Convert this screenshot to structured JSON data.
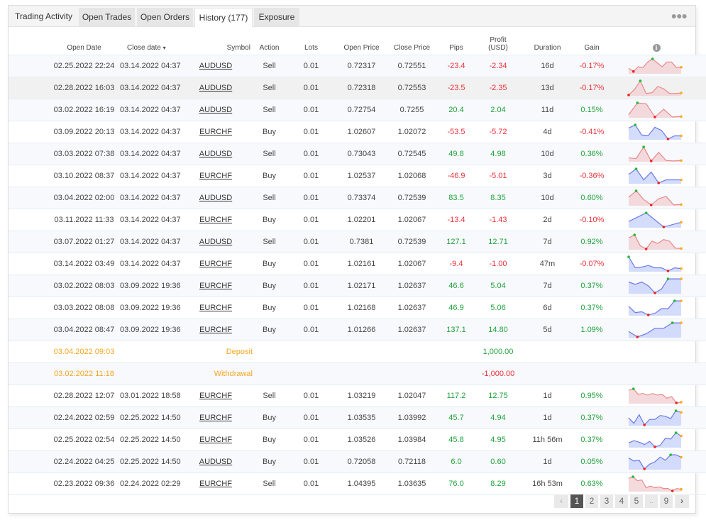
{
  "tabs": [
    {
      "label": "Trading Activity"
    },
    {
      "label": "Open Trades"
    },
    {
      "label": "Open Orders"
    },
    {
      "label": "History (177)",
      "active": true
    },
    {
      "label": "Exposure"
    }
  ],
  "more_icon": "ellipsis-icon",
  "columns": {
    "open_date": "Open Date",
    "close_date": "Close date",
    "close_date_sort": "▾",
    "symbol": "Symbol",
    "action": "Action",
    "lots": "Lots",
    "open_price": "Open Price",
    "close_price": "Close Price",
    "pips": "Pips",
    "profit_line1": "Profit",
    "profit_line2": "(USD)",
    "duration": "Duration",
    "gain": "Gain",
    "info_icon": "i"
  },
  "colors": {
    "positive": "#20a33c",
    "negative": "#e8333b",
    "transaction": "#f5a623",
    "sell_chart_line": "#e88a8a",
    "sell_chart_fill": "#f2d4d6",
    "buy_chart_line": "#6b79e6",
    "buy_chart_fill": "#cdd6fb",
    "marker_high": "#22bb33",
    "marker_low": "#ee2222",
    "marker_end": "#ffaa22"
  },
  "rows": [
    {
      "type": "trade",
      "open_date": "02.25.2022 22:24",
      "close_date": "03.14.2022 04:37",
      "symbol": "AUDUSD",
      "action": "Sell",
      "lots": "0.01",
      "open_price": "0.72317",
      "close_price": "0.72551",
      "pips": "-23.4",
      "profit": "-2.34",
      "duration": "16d",
      "gain": "-0.17%",
      "sign": "neg",
      "spark": [
        0.35,
        0.15,
        0.45,
        0.4,
        0.75,
        0.95,
        0.7,
        0.45,
        0.75,
        0.75,
        0.4,
        0.42
      ],
      "hi": 5,
      "lo": 1
    },
    {
      "type": "trade",
      "open_date": "02.28.2022 16:03",
      "close_date": "03.14.2022 04:37",
      "symbol": "AUDUSD",
      "action": "Sell",
      "lots": "0.01",
      "open_price": "0.72318",
      "close_price": "0.72553",
      "pips": "-23.5",
      "profit": "-2.35",
      "duration": "13d",
      "gain": "-0.17%",
      "sign": "neg",
      "spark": [
        0.05,
        0.4,
        0.95,
        0.15,
        0.2,
        0.6,
        0.45,
        0.15,
        0.15,
        0.18
      ],
      "hi": 2,
      "lo": 0
    },
    {
      "type": "trade",
      "open_date": "03.02.2022 16:19",
      "close_date": "03.14.2022 04:37",
      "symbol": "AUDUSD",
      "action": "Sell",
      "lots": "0.01",
      "open_price": "0.72754",
      "close_price": "0.7255",
      "pips": "20.4",
      "profit": "2.04",
      "duration": "11d",
      "gain": "0.15%",
      "sign": "pos",
      "spark": [
        0.2,
        0.95,
        0.9,
        0.05,
        0.55,
        0.05,
        0.08
      ],
      "hi": 1,
      "lo": 3
    },
    {
      "type": "trade",
      "open_date": "03.09.2022 20:13",
      "close_date": "03.14.2022 04:37",
      "symbol": "EURCHF",
      "action": "Buy",
      "lots": "0.01",
      "open_price": "1.02607",
      "close_price": "1.02072",
      "pips": "-53.5",
      "profit": "-5.72",
      "duration": "4d",
      "gain": "-0.41%",
      "sign": "neg",
      "spark": [
        0.75,
        0.95,
        0.3,
        0.28,
        0.8,
        0.6,
        0.05,
        0.25,
        0.25
      ],
      "hi": 1,
      "lo": 6
    },
    {
      "type": "trade",
      "open_date": "03.03.2022 07:38",
      "close_date": "03.14.2022 04:37",
      "symbol": "AUDUSD",
      "action": "Sell",
      "lots": "0.01",
      "open_price": "0.73043",
      "close_price": "0.72545",
      "pips": "49.8",
      "profit": "4.98",
      "duration": "10d",
      "gain": "0.36%",
      "sign": "pos",
      "spark": [
        0.25,
        0.2,
        0.95,
        0.05,
        0.6,
        0.08,
        0.05,
        0.08
      ],
      "hi": 2,
      "lo": 3
    },
    {
      "type": "trade",
      "open_date": "03.10.2022 08:37",
      "close_date": "03.14.2022 04:37",
      "symbol": "EURCHF",
      "action": "Buy",
      "lots": "0.01",
      "open_price": "1.02537",
      "close_price": "1.02068",
      "pips": "-46.9",
      "profit": "-5.01",
      "duration": "3d",
      "gain": "-0.36%",
      "sign": "neg",
      "spark": [
        0.6,
        0.95,
        0.25,
        0.75,
        0.05,
        0.25,
        0.25,
        0.25
      ],
      "hi": 1,
      "lo": 4
    },
    {
      "type": "trade",
      "open_date": "03.04.2022 02:00",
      "close_date": "03.14.2022 04:37",
      "symbol": "AUDUSD",
      "action": "Sell",
      "lots": "0.01",
      "open_price": "0.73374",
      "close_price": "0.72539",
      "pips": "83.5",
      "profit": "8.35",
      "duration": "10d",
      "gain": "0.60%",
      "sign": "pos",
      "spark": [
        0.55,
        0.95,
        0.4,
        0.05,
        0.45,
        0.6,
        0.05,
        0.08
      ],
      "hi": 1,
      "lo": 3
    },
    {
      "type": "trade",
      "open_date": "03.11.2022 11:33",
      "close_date": "03.14.2022 04:37",
      "symbol": "EURCHF",
      "action": "Buy",
      "lots": "0.01",
      "open_price": "1.02201",
      "close_price": "1.02067",
      "pips": "-13.4",
      "profit": "-1.43",
      "duration": "2d",
      "gain": "-0.10%",
      "sign": "neg",
      "spark": [
        0.4,
        0.95,
        0.05,
        0.35
      ],
      "hi": 1,
      "lo": 2
    },
    {
      "type": "trade",
      "open_date": "03.07.2022 01:27",
      "close_date": "03.14.2022 04:37",
      "symbol": "AUDUSD",
      "action": "Sell",
      "lots": "0.01",
      "open_price": "0.7381",
      "close_price": "0.72539",
      "pips": "127.1",
      "profit": "12.71",
      "duration": "7d",
      "gain": "0.92%",
      "sign": "pos",
      "spark": [
        0.75,
        0.95,
        0.25,
        0.05,
        0.55,
        0.4,
        0.65,
        0.55,
        0.1,
        0.08
      ],
      "hi": 1,
      "lo": 3
    },
    {
      "type": "trade",
      "open_date": "03.14.2022 03:49",
      "close_date": "03.14.2022 04:37",
      "symbol": "EURCHF",
      "action": "Buy",
      "lots": "0.01",
      "open_price": "1.02161",
      "close_price": "1.02067",
      "pips": "-9.4",
      "profit": "-1.00",
      "duration": "47m",
      "gain": "-0.07%",
      "sign": "neg",
      "spark": [
        0.95,
        0.25,
        0.3,
        0.4,
        0.25,
        0.25,
        0.05,
        0.25,
        0.2
      ],
      "hi": 0,
      "lo": 6
    },
    {
      "type": "trade",
      "open_date": "03.02.2022 08:03",
      "close_date": "03.09.2022 19:36",
      "symbol": "EURCHF",
      "action": "Buy",
      "lots": "0.01",
      "open_price": "1.02171",
      "close_price": "1.02637",
      "pips": "46.6",
      "profit": "5.04",
      "duration": "7d",
      "gain": "0.37%",
      "sign": "pos",
      "spark": [
        0.75,
        0.6,
        0.75,
        0.5,
        0.05,
        0.3,
        0.95,
        0.95,
        0.95
      ],
      "hi": 6,
      "lo": 4
    },
    {
      "type": "trade",
      "open_date": "03.03.2022 08:08",
      "close_date": "03.09.2022 19:36",
      "symbol": "EURCHF",
      "action": "Buy",
      "lots": "0.01",
      "open_price": "1.02168",
      "close_price": "1.02637",
      "pips": "46.9",
      "profit": "5.06",
      "duration": "6d",
      "gain": "0.37%",
      "sign": "pos",
      "spark": [
        0.6,
        0.2,
        0.25,
        0.05,
        0.15,
        0.45,
        0.45,
        0.95,
        0.95
      ],
      "hi": 7,
      "lo": 3
    },
    {
      "type": "trade",
      "open_date": "03.04.2022 08:47",
      "close_date": "03.09.2022 19:36",
      "symbol": "EURCHF",
      "action": "Buy",
      "lots": "0.01",
      "open_price": "1.01266",
      "close_price": "1.02637",
      "pips": "137.1",
      "profit": "14.80",
      "duration": "5d",
      "gain": "1.09%",
      "sign": "pos",
      "spark": [
        0.4,
        0.05,
        0.25,
        0.6,
        0.6,
        0.95,
        0.95
      ],
      "hi": 5,
      "lo": 1
    },
    {
      "type": "transaction",
      "open_date": "03.04.2022 09:03",
      "label": "Deposit",
      "profit": "1,000.00",
      "sign": "pos"
    },
    {
      "type": "transaction",
      "open_date": "03.02.2022 11:18",
      "label": "Withdrawal",
      "profit": "-1,000.00",
      "sign": "neg"
    },
    {
      "type": "trade",
      "open_date": "02.28.2022 12:07",
      "close_date": "03.01.2022 18:58",
      "symbol": "EURCHF",
      "action": "Sell",
      "lots": "0.01",
      "open_price": "1.03219",
      "close_price": "1.02047",
      "pips": "117.2",
      "profit": "12.75",
      "duration": "1d",
      "gain": "0.95%",
      "sign": "pos",
      "spark": [
        0.85,
        0.95,
        0.6,
        0.65,
        0.55,
        0.65,
        0.55,
        0.6,
        0.35,
        0.45,
        0.05,
        0.1
      ],
      "hi": 1,
      "lo": 10
    },
    {
      "type": "trade",
      "open_date": "02.24.2022 02:59",
      "close_date": "02.25.2022 14:50",
      "symbol": "EURCHF",
      "action": "Buy",
      "lots": "0.01",
      "open_price": "1.03535",
      "close_price": "1.03992",
      "pips": "45.7",
      "profit": "4.94",
      "duration": "1d",
      "gain": "0.37%",
      "sign": "pos",
      "spark": [
        0.5,
        0.15,
        0.7,
        0.05,
        0.4,
        0.4,
        0.65,
        0.6,
        0.45,
        0.95,
        0.85
      ],
      "hi": 9,
      "lo": 3
    },
    {
      "type": "trade",
      "open_date": "02.25.2022 02:54",
      "close_date": "02.25.2022 14:50",
      "symbol": "EURCHF",
      "action": "Buy",
      "lots": "0.01",
      "open_price": "1.03526",
      "close_price": "1.03984",
      "pips": "45.8",
      "profit": "4.95",
      "duration": "11h 56m",
      "gain": "0.37%",
      "sign": "pos",
      "spark": [
        0.3,
        0.45,
        0.35,
        0.2,
        0.4,
        0.05,
        0.15,
        0.6,
        0.55,
        0.95,
        0.75
      ],
      "hi": 9,
      "lo": 5
    },
    {
      "type": "trade",
      "open_date": "02.24.2022 04:25",
      "close_date": "02.25.2022 14:50",
      "symbol": "AUDUSD",
      "action": "Buy",
      "lots": "0.01",
      "open_price": "0.72058",
      "close_price": "0.72118",
      "pips": "6.0",
      "profit": "0.60",
      "duration": "1d",
      "gain": "0.05%",
      "sign": "pos",
      "spark": [
        0.75,
        0.55,
        0.6,
        0.05,
        0.35,
        0.5,
        0.8,
        0.6,
        0.95,
        0.95,
        0.8
      ],
      "hi": 8,
      "lo": 3
    },
    {
      "type": "trade",
      "open_date": "02.23.2022 09:36",
      "close_date": "02.24.2022 02:29",
      "symbol": "EURCHF",
      "action": "Sell",
      "lots": "0.01",
      "open_price": "1.04395",
      "close_price": "1.03635",
      "pips": "76.0",
      "profit": "8.29",
      "duration": "16h 53m",
      "gain": "0.63%",
      "sign": "pos",
      "spark": [
        0.85,
        0.95,
        0.7,
        0.75,
        0.25,
        0.35,
        0.25,
        0.3,
        0.2,
        0.2,
        0.05,
        0.2,
        0.15
      ],
      "hi": 1,
      "lo": 10
    }
  ],
  "pagination": {
    "prev": "‹",
    "pages": [
      "1",
      "2",
      "3",
      "4",
      "5"
    ],
    "current": "1",
    "ellipsis": "..",
    "last": "9",
    "next": "›"
  }
}
